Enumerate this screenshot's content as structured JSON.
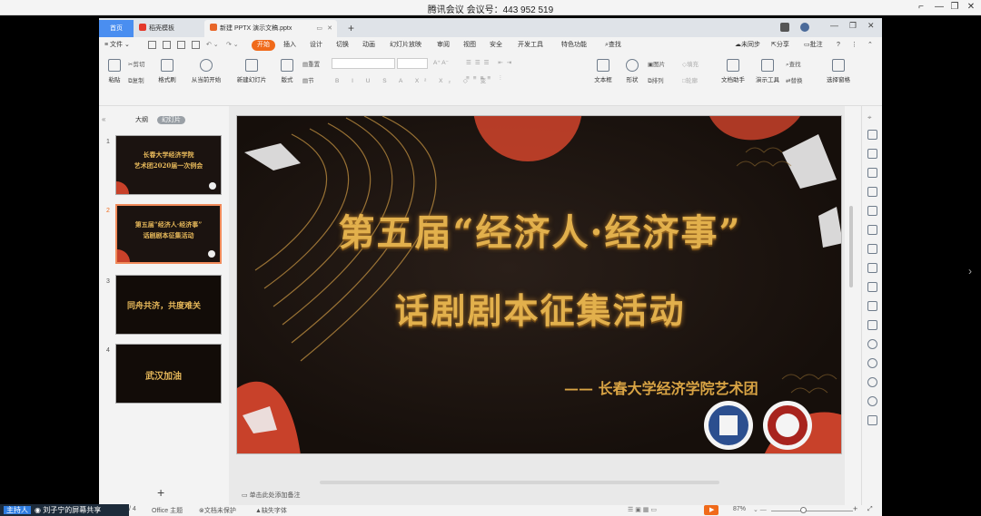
{
  "meeting": {
    "title": "腾讯会议 会议号：443 952 519"
  },
  "tabs": {
    "home": "首页",
    "daoke": "稻壳模板",
    "doc": "新建 PPTX 演示文稿.pptx",
    "add": "+"
  },
  "menubar": {
    "file": "文件",
    "items": [
      "开始",
      "插入",
      "设计",
      "切换",
      "动画",
      "幻灯片放映",
      "审阅",
      "视图",
      "安全",
      "开发工具",
      "特色功能",
      "查找"
    ],
    "right": [
      "未同步",
      "分享",
      "批注"
    ]
  },
  "ribbon": {
    "paste": "粘贴",
    "cut": "剪切",
    "copy": "复制",
    "format_painter": "格式刷",
    "from_current": "从当前开始",
    "new_slide": "新建幻灯片",
    "layout": "版式",
    "section": "节",
    "reset": "重置",
    "textbox": "文本框",
    "shape": "形状",
    "picture": "图片",
    "fill": "填充",
    "arrange": "排列",
    "outline": "轮廓",
    "doc_assistant": "文档助手",
    "present_tool": "演示工具",
    "find": "查找",
    "replace": "替换",
    "select_pane": "选择窗格"
  },
  "leftpanel": {
    "tab_outline": "大纲",
    "tab_slides": "幻灯片",
    "thumbs": [
      {
        "num": "1",
        "line1": "长春大学经济学院",
        "line2": "艺术团2020届一次例会"
      },
      {
        "num": "2",
        "line1": "第五届“经济人·经济事”",
        "line2": "话剧剧本征集活动"
      },
      {
        "num": "3",
        "line1": "同舟共济，共度难关",
        "line2": ""
      },
      {
        "num": "4",
        "line1": "武汉加油",
        "line2": ""
      }
    ],
    "add": "+"
  },
  "slide": {
    "title_line1": "第五届“经济人·经济事”",
    "title_line2": "话剧剧本征集活动",
    "subtitle": "—— 长春大学经济学院艺术团"
  },
  "notes": {
    "placeholder": "单击此处添加备注"
  },
  "statusbar": {
    "page": "/ 4",
    "theme": "Office 主题",
    "protect": "文档未保护",
    "missing_font": "缺失字体",
    "zoom": "87%"
  },
  "host": {
    "tag": "主持人",
    "label": "刘子宁的屏幕共享"
  },
  "colors": {
    "accent_orange": "#f06a1a",
    "home_tab": "#4a8ef0",
    "slide_gold": "#e2b04c",
    "slide_bg": "#1b1310",
    "slide_red": "#c8412a"
  }
}
